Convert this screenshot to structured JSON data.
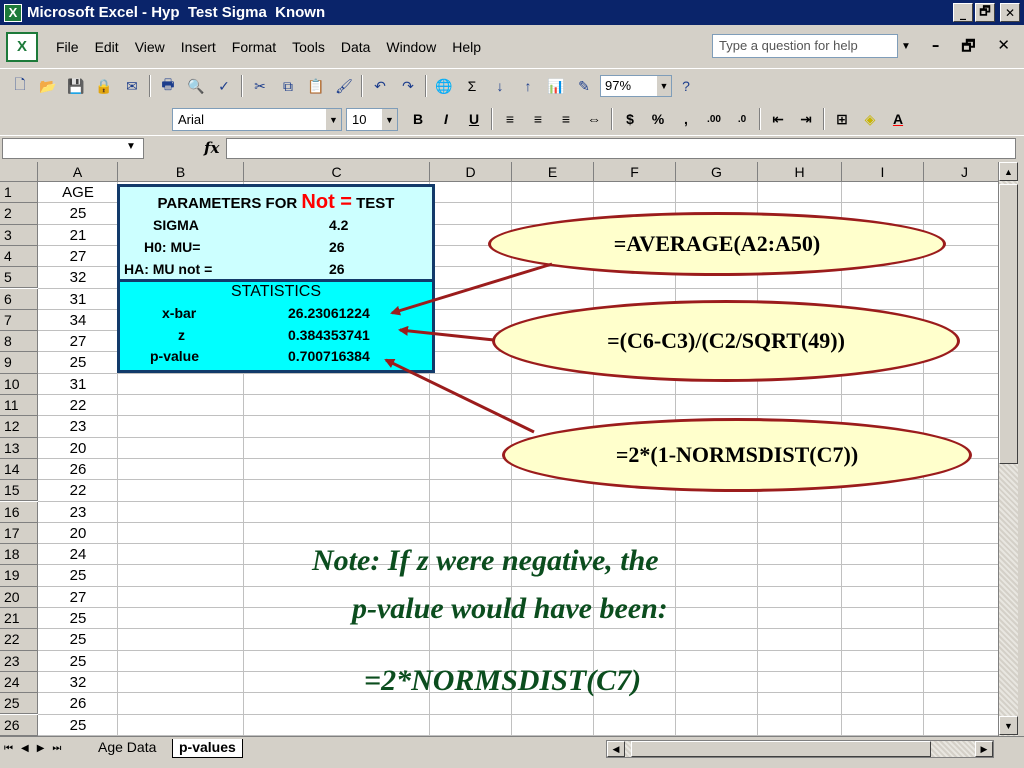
{
  "window": {
    "title": "Microsoft Excel - Hyp  Test Sigma  Known",
    "minimize_glyph": "_",
    "restore_glyph": "🗗",
    "close_glyph": "✕"
  },
  "menubar": {
    "items": [
      "File",
      "Edit",
      "View",
      "Insert",
      "Format",
      "Tools",
      "Data",
      "Window",
      "Help"
    ],
    "ask_placeholder": "Type a question for help"
  },
  "toolbar": {
    "zoom": "97%",
    "font_name": "Arial",
    "font_size": "10"
  },
  "formula_bar": {
    "name_box": "",
    "fx_label": "fx",
    "formula": ""
  },
  "columns": [
    "A",
    "B",
    "C",
    "D",
    "E",
    "F",
    "G",
    "H",
    "I",
    "J"
  ],
  "rows": [
    "1",
    "2",
    "3",
    "4",
    "5",
    "6",
    "7",
    "8",
    "9",
    "10",
    "11",
    "12",
    "13",
    "14",
    "15",
    "16",
    "17",
    "18",
    "19",
    "20",
    "21",
    "22",
    "23",
    "24",
    "25",
    "26"
  ],
  "column_a": [
    "AGE",
    "25",
    "21",
    "27",
    "32",
    "31",
    "34",
    "27",
    "25",
    "31",
    "22",
    "23",
    "20",
    "26",
    "22",
    "23",
    "20",
    "24",
    "25",
    "27",
    "25",
    "25",
    "25",
    "32",
    "26",
    "25"
  ],
  "parameters": {
    "title_prefix": "PARAMETERS FOR ",
    "title_not": "Not =",
    "title_suffix": " TEST",
    "sigma_label": "SIGMA",
    "sigma_value": "4.2",
    "h0_label": "H0:  MU=",
    "h0_value": "26",
    "ha_label": "HA:  MU not =",
    "ha_value": "26"
  },
  "statistics": {
    "title": "STATISTICS",
    "xbar_label": "x-bar",
    "xbar_value": "26.23061224",
    "z_label": "z",
    "z_value": "0.384353741",
    "p_label": "p-value",
    "p_value": "0.700716384"
  },
  "callouts": {
    "average": "=AVERAGE(A2:A50)",
    "z": "=(C6-C3)/(C2/SQRT(49))",
    "p": "=2*(1-NORMSDIST(C7))"
  },
  "note": {
    "line1": "Note:  If z were negative, the",
    "line2": "p-value would have been:",
    "formula": "=2*NORMSDIST(C7)"
  },
  "sheet_tabs": [
    "Age Data",
    "p-values"
  ],
  "colors": {
    "titlebar": "#0a246a",
    "param_bg": "#ccffff",
    "stats_bg": "#00ffff",
    "arrow": "#9b1c1c",
    "callout_bg": "#ffffcc",
    "note_text": "#0b4d1e",
    "not_red": "#ff0000"
  }
}
